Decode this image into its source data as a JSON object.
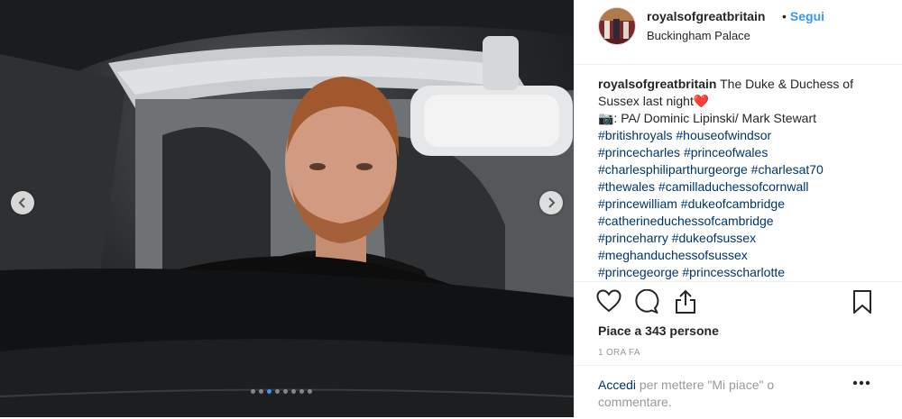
{
  "post": {
    "username": "royalsofgreatbritain",
    "bullet": "•",
    "follow_label": "Segui",
    "location": "Buckingham Palace",
    "caption_user": "royalsofgreatbritain",
    "caption_text": "The Duke & Duchess of Sussex last night",
    "heart_emoji": "❤️",
    "credit": "📷: PA/ Dominic Lipinski/ Mark Stewart",
    "hashtags": [
      "#britishroyals #houseofwindsor",
      "#princecharles #princeofwales",
      "#charlesphiliparthurgeorge #charlesat70",
      "#thewales #camilladuchessofcornwall",
      "#princewilliam #dukeofcambridge",
      "#catherineduchessofcambridge",
      "#princeharry #dukeofsussex",
      "#meghanduchessofsussex",
      "#princegeorge #princesscharlotte"
    ],
    "likes": "Piace a 343 persone",
    "timestamp": "1 ORA FA",
    "comment_prompt_link": "Accedi",
    "comment_prompt_rest": " per mettere \"Mi piace\" o commentare."
  },
  "carousel": {
    "total": 8,
    "active_index": 2
  },
  "colors": {
    "link_blue": "#3897f0",
    "hashtag": "#003569",
    "muted": "#999999"
  },
  "icons": [
    "chevron-left-icon",
    "chevron-right-icon",
    "heart-icon",
    "comment-icon",
    "share-icon",
    "bookmark-icon",
    "more-dots-icon"
  ]
}
